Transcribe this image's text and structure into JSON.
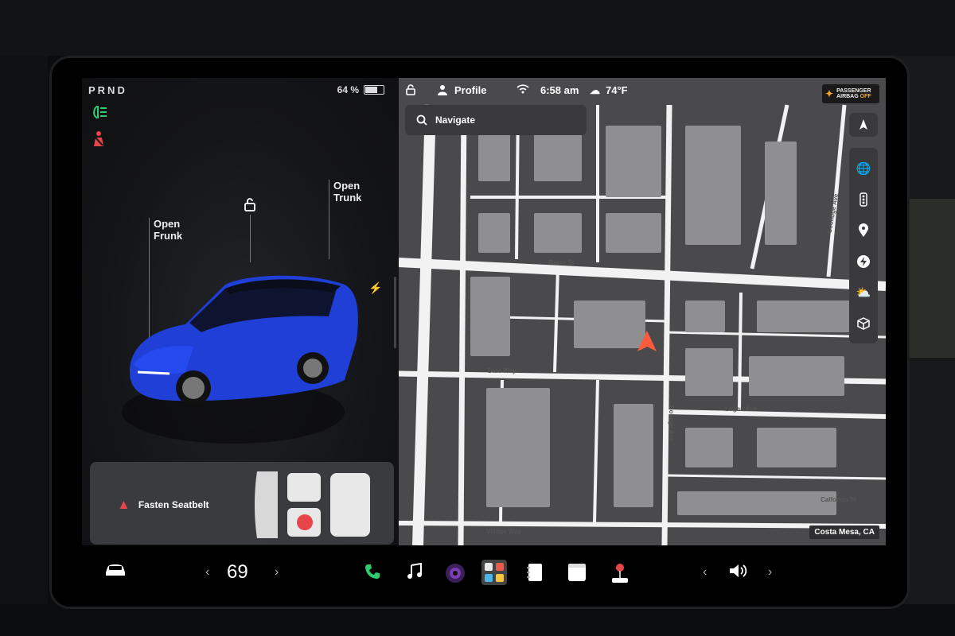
{
  "status": {
    "gear": "PRND",
    "battery_percent": "64 %",
    "battery_level": 0.64,
    "profile_label": "Profile",
    "time": "6:58 am",
    "temperature": "74°F"
  },
  "airbag": {
    "line1": "PASSENGER",
    "line2": "AIRBAG",
    "state": "OFF"
  },
  "car_panel": {
    "open_frunk": [
      "Open",
      "Frunk"
    ],
    "open_trunk": [
      "Open",
      "Trunk"
    ],
    "seatbelt_warning": "Fasten Seatbelt",
    "car_color": "#1f3fd6"
  },
  "map": {
    "search_placeholder": "Navigate",
    "location": "Costa Mesa, CA",
    "streets": [
      "Baker St",
      "Dale Way",
      "Logan Ave",
      "College Ave",
      "Village Way",
      "Coolidge Ave",
      "Calfornia St"
    ]
  },
  "map_tools": [
    "globe-icon",
    "traffic-icon",
    "pin-icon",
    "charging-icon",
    "weather-icon",
    "cube-icon"
  ],
  "dock": {
    "cabin_temp": "69",
    "apps": [
      "phone-icon",
      "music-icon",
      "camera-icon",
      "app-launcher-icon",
      "notes-icon",
      "calendar-icon",
      "joystick-icon"
    ]
  },
  "colors": {
    "accent_green": "#2ecc71",
    "warning_red": "#e8454a",
    "nav_arrow": "#ff5a3c"
  }
}
